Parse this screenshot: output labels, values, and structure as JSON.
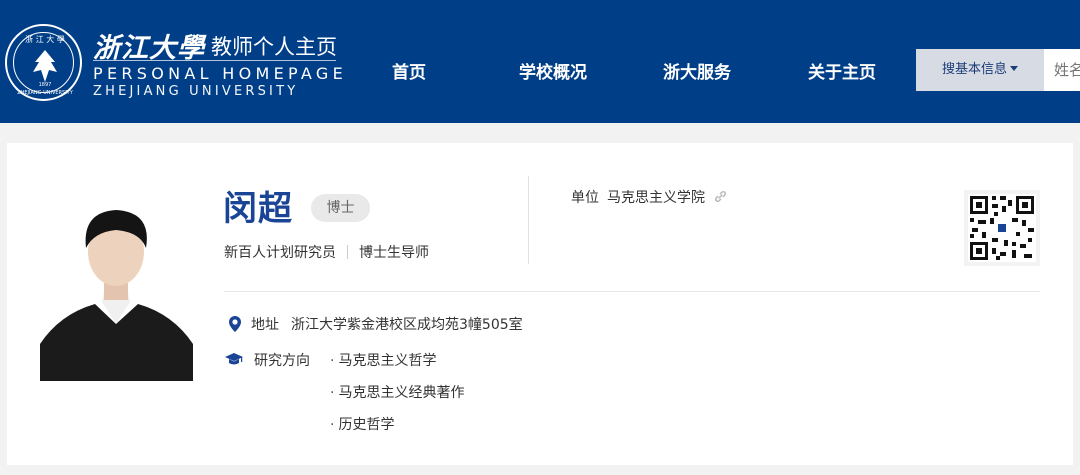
{
  "header": {
    "logo_label": "浙江大學 ZHEJIANG UNIVERSITY 1897",
    "brand_script": "浙江大學",
    "brand_cn": "教师个人主页",
    "brand_en": "PERSONAL HOMEPAGE",
    "brand_en2": "ZHEJIANG UNIVERSITY",
    "bg_color": "#003f88"
  },
  "nav": {
    "items": [
      {
        "label": "首页"
      },
      {
        "label": "学校概况"
      },
      {
        "label": "浙大服务"
      },
      {
        "label": "关于主页"
      }
    ]
  },
  "search": {
    "select_label": "搜基本信息",
    "input_placeholder": "姓名"
  },
  "profile": {
    "name": "闵超",
    "degree": "博士",
    "title1": "新百人计划研究员",
    "title2": "博士生导师",
    "unit_label": "单位",
    "unit_value": "马克思主义学院",
    "address_label": "地址",
    "address_value": "浙江大学紫金港校区成均苑3幢505室",
    "research_label": "研究方向",
    "research": [
      "马克思主义哲学",
      "马克思主义经典著作",
      "历史哲学"
    ],
    "accent_color": "#1a4596"
  }
}
